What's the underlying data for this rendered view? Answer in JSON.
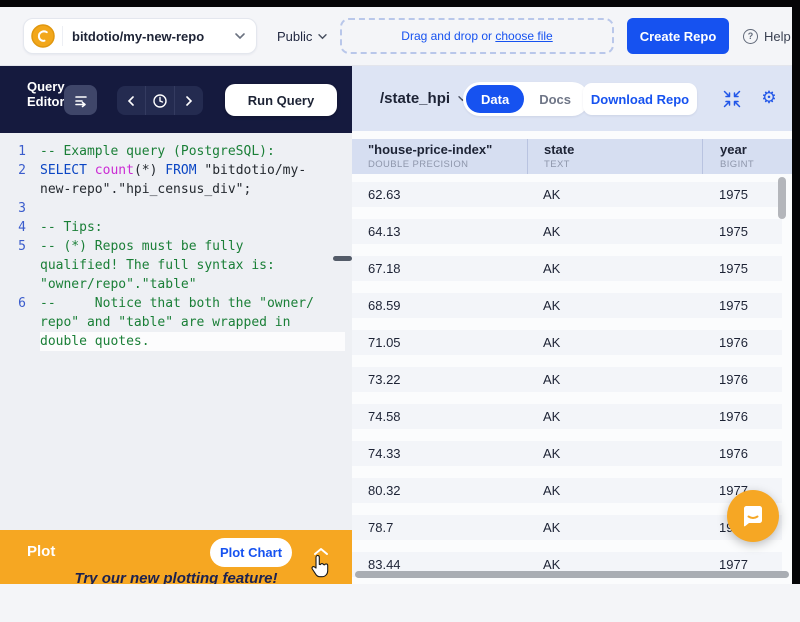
{
  "top_bar": {
    "repo_selector": {
      "label": "bitdotio/my-new-repo"
    },
    "visibility": {
      "label": "Public"
    },
    "upload": {
      "text_prefix": "Drag and drop or ",
      "link_text": "choose file"
    },
    "create_repo_label": "Create Repo",
    "help": {
      "icon_glyph": "?",
      "label": "Help"
    }
  },
  "query_editor": {
    "title_line1": "Query",
    "title_line2": "Editor",
    "run_button_label": "Run Query",
    "code_lines": [
      {
        "num": "1",
        "tokens": [
          {
            "c": "comment",
            "t": "-- Example query (PostgreSQL):"
          }
        ]
      },
      {
        "num": "2",
        "tokens": [
          {
            "c": "keyword",
            "t": "SELECT"
          },
          {
            "c": "plain",
            "t": " "
          },
          {
            "c": "func",
            "t": "count"
          },
          {
            "c": "plain",
            "t": "(*) "
          },
          {
            "c": "keyword",
            "t": "FROM"
          },
          {
            "c": "plain",
            "t": " \"bitdotio/my-new-repo\".\"hpi_census_div\";"
          }
        ]
      },
      {
        "num": "3",
        "tokens": []
      },
      {
        "num": "4",
        "tokens": [
          {
            "c": "comment",
            "t": "-- Tips:"
          }
        ]
      },
      {
        "num": "5",
        "tokens": [
          {
            "c": "comment",
            "t": "-- (*) Repos must be fully qualified! The full syntax is: \"owner/repo\".\"table\""
          }
        ]
      },
      {
        "num": "6",
        "tokens": [
          {
            "c": "comment",
            "t": "--     Notice that both the \"owner/repo\" and \"table\" are wrapped in double quotes."
          }
        ]
      }
    ]
  },
  "plot_bar": {
    "title": "Plot",
    "button_label": "Plot Chart",
    "banner_text": "Try our new plotting feature!"
  },
  "table_panel": {
    "table_selector_label": "/state_hpi",
    "tabs": [
      {
        "label": "Data",
        "active": true
      },
      {
        "label": "Docs",
        "active": false
      }
    ],
    "download_label": "Download Repo",
    "columns": [
      {
        "name": "\"house-price-index\"",
        "type": "DOUBLE PRECISION"
      },
      {
        "name": "state",
        "type": "TEXT"
      },
      {
        "name": "year",
        "type": "BIGINT"
      }
    ],
    "rows": [
      [
        "62.63",
        "AK",
        "1975"
      ],
      [
        "64.13",
        "AK",
        "1975"
      ],
      [
        "67.18",
        "AK",
        "1975"
      ],
      [
        "68.59",
        "AK",
        "1975"
      ],
      [
        "71.05",
        "AK",
        "1976"
      ],
      [
        "73.22",
        "AK",
        "1976"
      ],
      [
        "74.58",
        "AK",
        "1976"
      ],
      [
        "74.33",
        "AK",
        "1976"
      ],
      [
        "80.32",
        "AK",
        "1977"
      ],
      [
        "78.7",
        "AK",
        "1977"
      ],
      [
        "83.44",
        "AK",
        "1977"
      ]
    ]
  },
  "colors": {
    "brand_blue": "#1652F0",
    "navy_panel": "#151A3E",
    "plot_orange": "#F6A722",
    "header_lavender": "#dde4f4",
    "comment_green": "#1a7f37",
    "keyword_blue": "#0b46c4",
    "function_magenta": "#cb2bd4"
  }
}
